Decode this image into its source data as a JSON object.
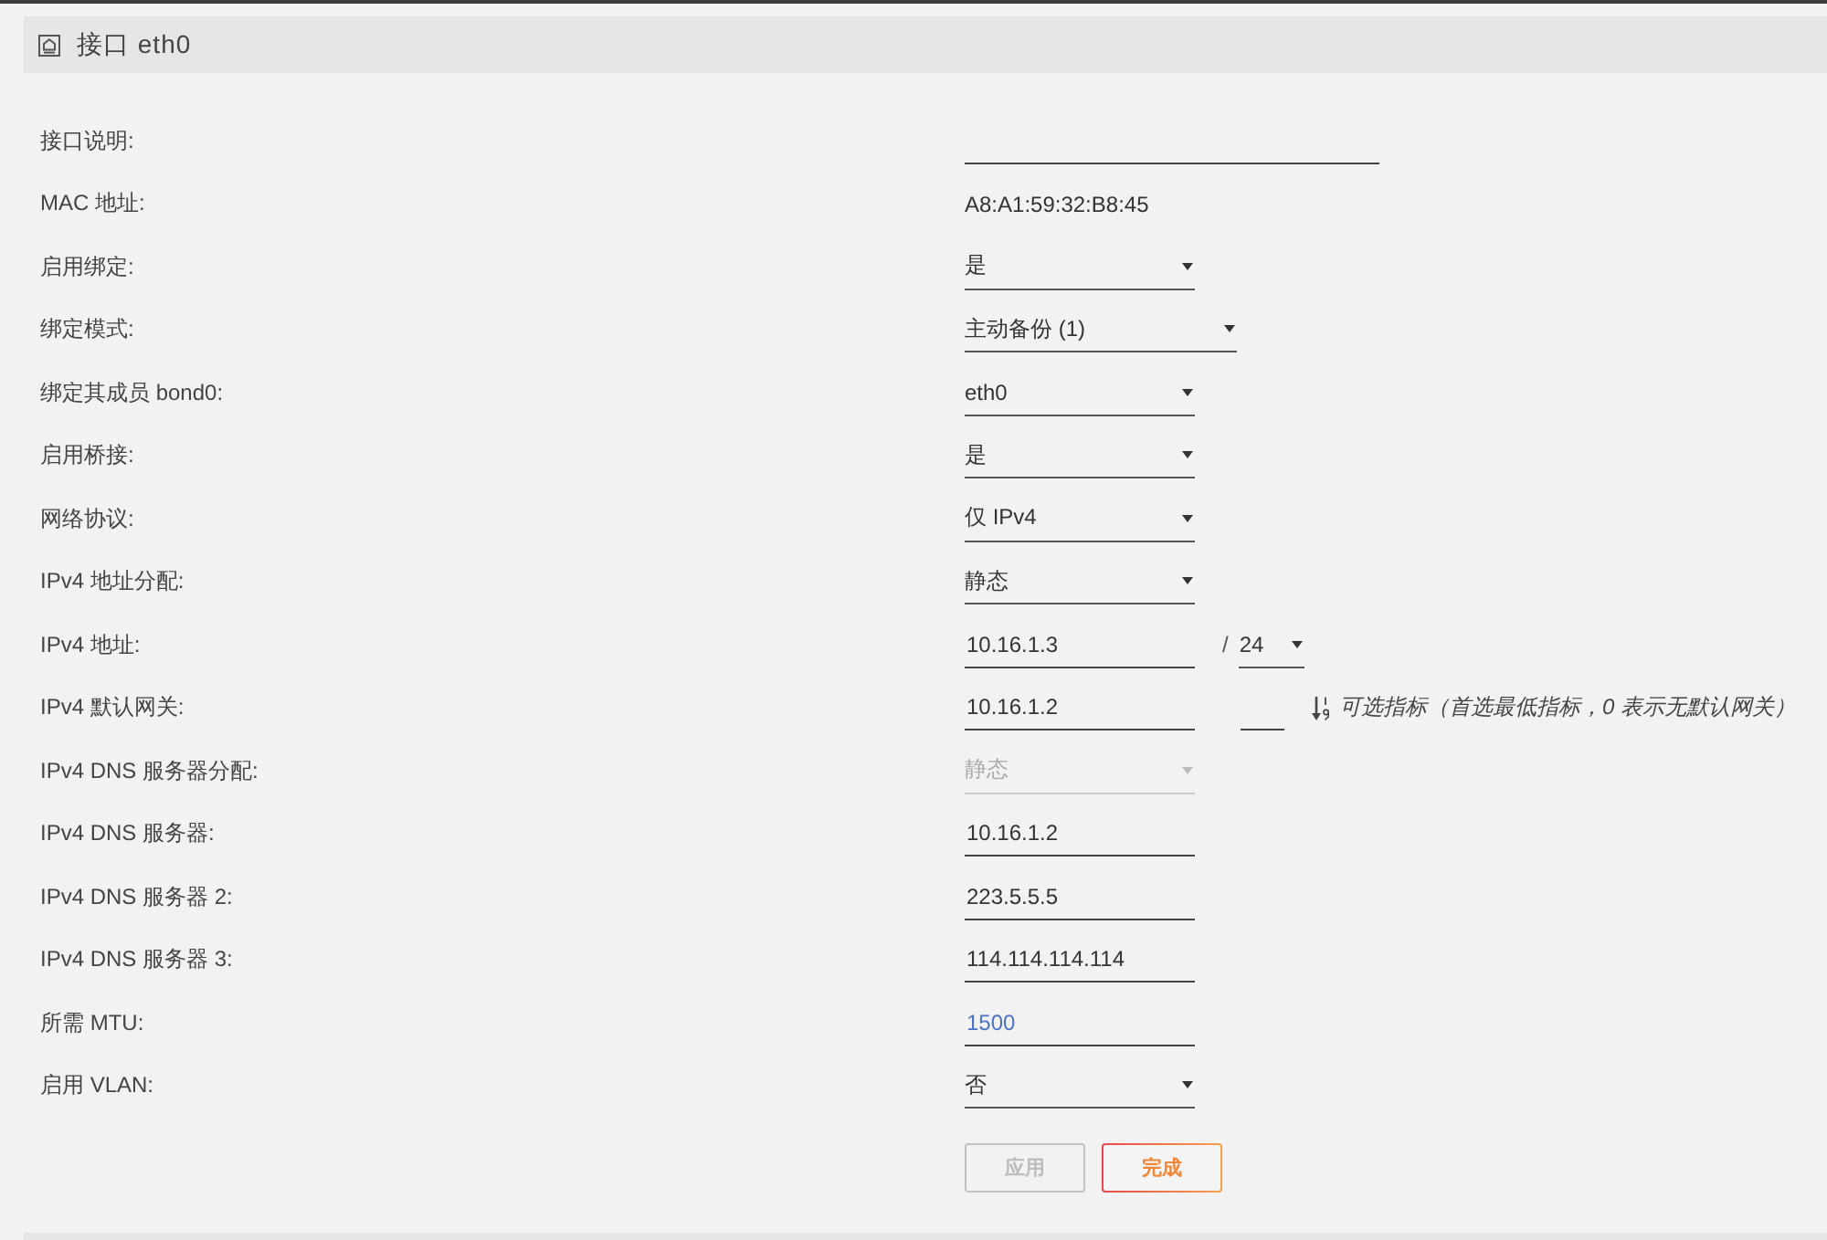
{
  "panel": {
    "title": "接口 eth0"
  },
  "fields": [
    {
      "kind": "long_input",
      "label": "接口说明:",
      "disabled": false
    },
    {
      "kind": "text",
      "label": "MAC 地址:",
      "value": "A8:A1:59:32:B8:45",
      "disabled": false
    },
    {
      "kind": "select",
      "label": "启用绑定:",
      "value": "是",
      "disabled": false
    },
    {
      "kind": "select",
      "label": "绑定模式:",
      "value": "主动备份 (1)",
      "disabled": false
    },
    {
      "kind": "select",
      "label": "绑定其成员 bond0:",
      "value": "eth0",
      "disabled": false
    },
    {
      "kind": "select",
      "label": "启用桥接:",
      "value": "是",
      "disabled": false
    },
    {
      "kind": "select",
      "label": "网络协议:",
      "value": "仅 IPv4",
      "disabled": false
    },
    {
      "kind": "select",
      "label": "IPv4 地址分配:",
      "value": "静态",
      "disabled": false
    },
    {
      "kind": "address",
      "label": "IPv4 地址:",
      "value": "10.16.1.3",
      "separator": "/",
      "prefix": "24",
      "disabled": false
    },
    {
      "kind": "gateway",
      "label": "IPv4 默认网关:",
      "value": "10.16.1.2",
      "hint": "可选指标（首选最低指标，0 表示无默认网关）",
      "disabled": false
    },
    {
      "kind": "select",
      "label": "IPv4 DNS 服务器分配:",
      "value": "静态",
      "disabled": true
    },
    {
      "kind": "input",
      "label": "IPv4 DNS 服务器:",
      "value": "10.16.1.2",
      "disabled": false
    },
    {
      "kind": "input",
      "label": "IPv4 DNS 服务器 2:",
      "value": "223.5.5.5",
      "disabled": false
    },
    {
      "kind": "input",
      "label": "IPv4 DNS 服务器 3:",
      "value": "114.114.114.114",
      "disabled": false
    },
    {
      "kind": "input",
      "label": "所需 MTU:",
      "placeholder": "1500",
      "disabled": false
    },
    {
      "kind": "select",
      "label": "启用 VLAN:",
      "value": "否",
      "disabled": false
    }
  ],
  "buttons": [
    {
      "label": "应用",
      "disabled": true
    },
    {
      "label": "完成",
      "disabled": false
    }
  ]
}
